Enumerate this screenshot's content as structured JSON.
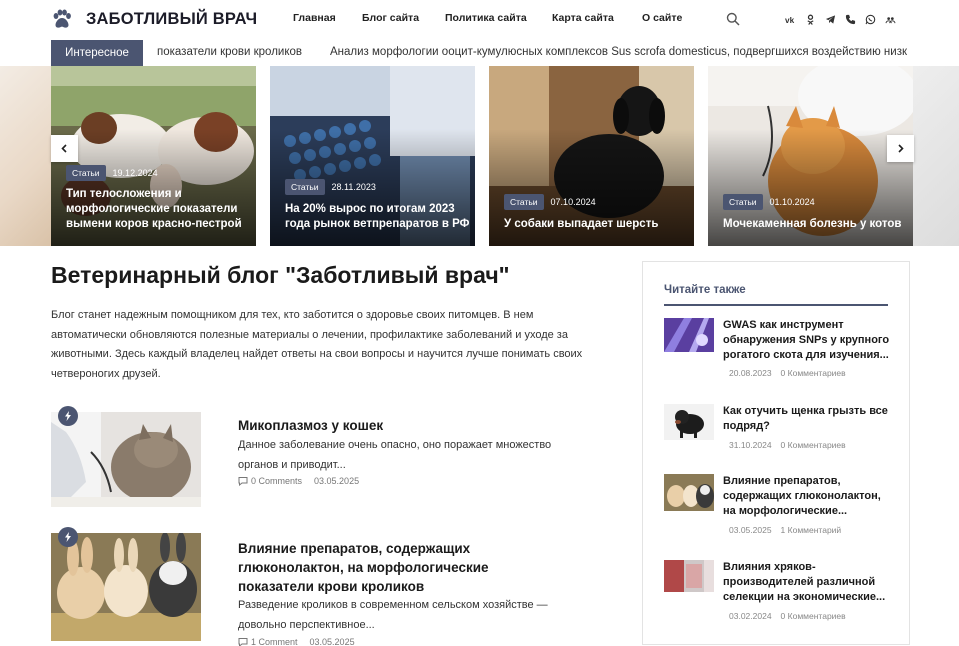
{
  "site": {
    "name": "ЗАБОТЛИВЫЙ ВРАЧ",
    "logo_icon": "paw-icon"
  },
  "nav": [
    {
      "label": "Главная"
    },
    {
      "label": "Блог сайта"
    },
    {
      "label": "Политика сайта"
    },
    {
      "label": "Карта сайта"
    },
    {
      "label": "О сайте"
    }
  ],
  "social_icons": [
    "vk-icon",
    "odnoklassniki-icon",
    "telegram-icon",
    "phone-icon",
    "whatsapp-icon",
    "people-icon"
  ],
  "ticker": {
    "label": "Интересное",
    "items": [
      "показатели крови кроликов",
      "Анализ морфологии ооцит-кумулюсных комплексов Sus scrofa domesticus, подвергшихся воздействию низк"
    ]
  },
  "slides": [
    {
      "badge": "Статьи",
      "date": "19.12.2024",
      "title": "Тип телосложения и морфологические показатели вымени коров красно-пестрой"
    },
    {
      "badge": "Статьи",
      "date": "28.11.2023",
      "title": "На 20% вырос по итогам 2023 года рынок ветпрепаратов в РФ"
    },
    {
      "badge": "Статьи",
      "date": "07.10.2024",
      "title": "У собаки выпадает шерсть"
    },
    {
      "badge": "Статьи",
      "date": "01.10.2024",
      "title": "Мочекаменная болезнь у котов"
    }
  ],
  "main": {
    "title": "Ветеринарный блог \"Заботливый врач\"",
    "intro": "Блог станет надежным помощником для тех, кто заботится о здоровье своих питомцев. В нем автоматически обновляются полезные материалы о лечении, профилактике заболеваний и уходе за животными. Здесь каждый владелец найдет ответы на свои вопросы и научится лучше понимать своих четвероногих друзей.",
    "posts": [
      {
        "title": "Микоплазмоз у кошек",
        "excerpt": "Данное заболевание очень опасно, оно поражает множество органов и приводит...",
        "comments": "0 Comments",
        "date": "03.05.2025"
      },
      {
        "title": "Влияние препаратов, содержащих глюконолактон, на морфологические показатели крови кроликов",
        "excerpt": "  Разведение кроликов в современном сельском хозяйстве — довольно перспективное...",
        "comments": "1 Comment",
        "date": "03.05.2025"
      }
    ]
  },
  "sidebar": {
    "heading": "Читайте также",
    "items": [
      {
        "title": "GWAS как инструмент обнаружения SNPs у крупного рогатого скота для изучения...",
        "date": "20.08.2023",
        "comments": "0 Комментариев"
      },
      {
        "title": "Как отучить щенка грызть все подряд?",
        "date": "31.10.2024",
        "comments": "0 Комментариев"
      },
      {
        "title": "Влияние препаратов, содержащих глюконолактон, на морфологические...",
        "date": "03.05.2025",
        "comments": "1 Комментарий"
      },
      {
        "title": "Влияния хряков-производителей различной селекции на экономические...",
        "date": "03.02.2024",
        "comments": "0 Комментариев"
      }
    ]
  },
  "colors": {
    "accent": "#4b5571"
  }
}
